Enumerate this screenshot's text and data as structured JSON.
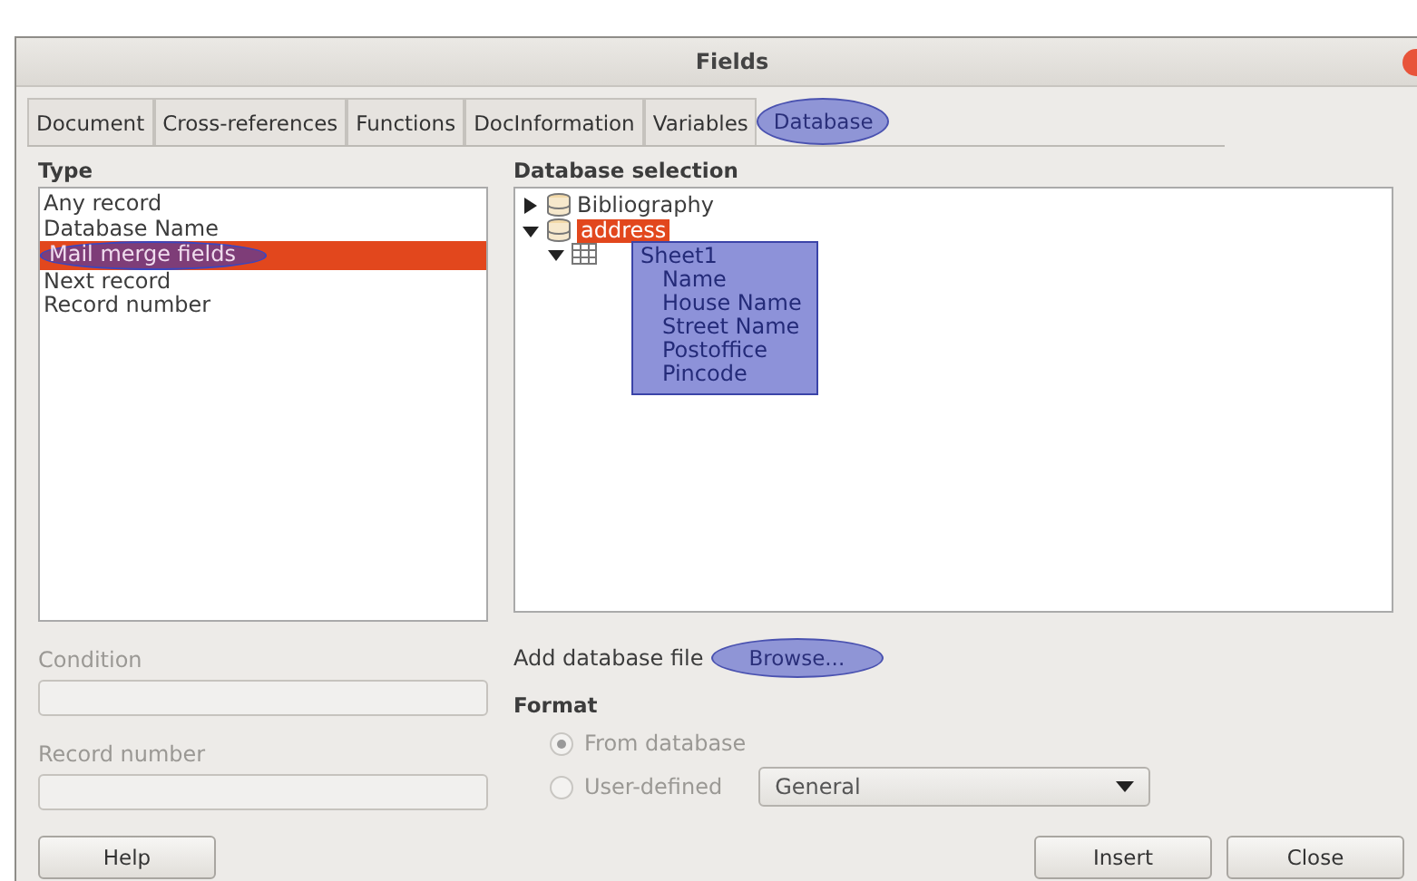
{
  "window": {
    "title": "Fields"
  },
  "tabs": [
    {
      "label": "Document",
      "selected": false,
      "highlighted": false
    },
    {
      "label": "Cross-references",
      "selected": false,
      "highlighted": false
    },
    {
      "label": "Functions",
      "selected": false,
      "highlighted": false
    },
    {
      "label": "DocInformation",
      "selected": false,
      "highlighted": false
    },
    {
      "label": "Variables",
      "selected": false,
      "highlighted": false
    },
    {
      "label": "Database",
      "selected": true,
      "highlighted": true
    }
  ],
  "type": {
    "label": "Type",
    "items": [
      {
        "label": "Any record",
        "selected": false,
        "highlighted": false
      },
      {
        "label": "Database Name",
        "selected": false,
        "highlighted": false
      },
      {
        "label": "Mail merge fields",
        "selected": true,
        "highlighted": true
      },
      {
        "label": "Next record",
        "selected": false,
        "highlighted": false
      },
      {
        "label": "Record number",
        "selected": false,
        "highlighted": false
      }
    ]
  },
  "database_selection": {
    "label": "Database selection",
    "tree": [
      {
        "label": "Bibliography",
        "kind": "database",
        "expanded": false,
        "selected": false
      },
      {
        "label": "address",
        "kind": "database",
        "expanded": true,
        "selected": true,
        "children": [
          {
            "label": "Sheet1",
            "kind": "table",
            "expanded": true,
            "selected": false,
            "highlighted": true,
            "children": [
              {
                "label": "Name",
                "selected": false
              },
              {
                "label": "House Name",
                "selected": false
              },
              {
                "label": "Street Name",
                "selected": false
              },
              {
                "label": "Postoffice",
                "selected": false
              },
              {
                "label": "Pincode",
                "selected": false
              }
            ]
          }
        ]
      }
    ]
  },
  "condition": {
    "label": "Condition",
    "disabled": true
  },
  "record_number": {
    "label": "Record number",
    "disabled": true
  },
  "add_database_file": {
    "label": "Add database file",
    "button": "Browse...",
    "highlighted": true
  },
  "format": {
    "label": "Format",
    "options": [
      {
        "label": "From database",
        "selected": true,
        "disabled": true
      },
      {
        "label": "User-defined",
        "selected": false,
        "disabled": true
      }
    ],
    "dropdown": "General"
  },
  "buttons": {
    "help": "Help",
    "insert": "Insert",
    "close": "Close"
  }
}
